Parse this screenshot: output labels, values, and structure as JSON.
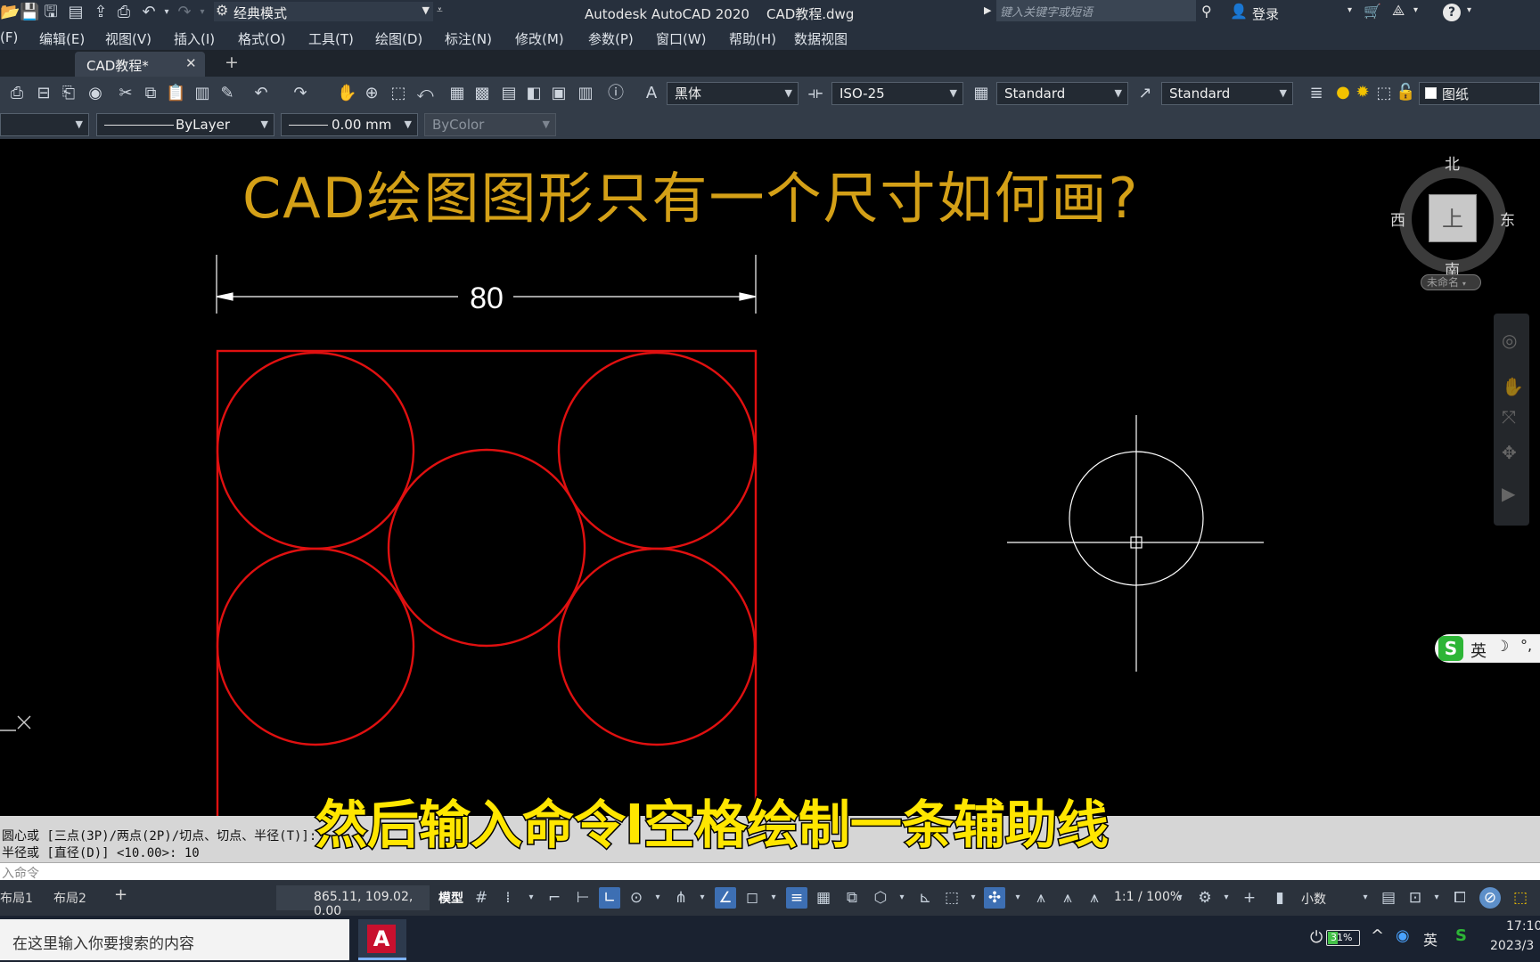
{
  "title": {
    "workspace": "经典模式",
    "app_title": "Autodesk AutoCAD 2020    CAD教程.dwg",
    "search_placeholder": "键入关键字或短语",
    "login": "登录",
    "help": "?"
  },
  "menu": {
    "items": [
      "(F)",
      "编辑(E)",
      "视图(V)",
      "插入(I)",
      "格式(O)",
      "工具(T)",
      "绘图(D)",
      "标注(N)",
      "修改(M)",
      "参数(P)",
      "窗口(W)",
      "帮助(H)",
      "数据视图"
    ]
  },
  "tabs": {
    "active": "CAD教程*",
    "close": "✕",
    "add": "+"
  },
  "toolbar1": {
    "text_style": "黑体",
    "dim_style": "ISO-25",
    "table_style": "Standard",
    "multileader_style": "Standard",
    "paper_label": "图纸"
  },
  "toolbar2": {
    "linetype": "ByLayer",
    "lineweight": "0.00 mm",
    "color": "ByColor"
  },
  "canvas": {
    "heading": "CAD绘图图形只有一个尺寸如何画?",
    "dimension_value": "80",
    "viewcube": {
      "north": "北",
      "south": "南",
      "west": "西",
      "east": "东",
      "top": "上",
      "ucs_label": "未命名"
    },
    "ime": "英",
    "subtitle": "然后输入命令l空格绘制一条辅助线",
    "ucs_icon": "X",
    "colors": {
      "heading": "#d4a017",
      "geometry": "#e01010",
      "crosshair": "#ffffff",
      "subtitle": "#ffe600"
    }
  },
  "command": {
    "line1": "圆心或 [三点(3P)/两点(2P)/切点、切点、半径(T)]:",
    "line2": "半径或 [直径(D)] <10.00>: 10",
    "input_placeholder": "入命令"
  },
  "status": {
    "layout1": "布局1",
    "layout2": "布局2",
    "add": "+",
    "coords": "865.11, 109.02, 0.00",
    "model": "模型",
    "scale": "1:1 / 100%",
    "units": "小数"
  },
  "taskbar": {
    "search_placeholder": "在这里输入你要搜索的内容",
    "battery": "31%",
    "ime": "英",
    "time": "17:10",
    "date": "2023/3"
  }
}
